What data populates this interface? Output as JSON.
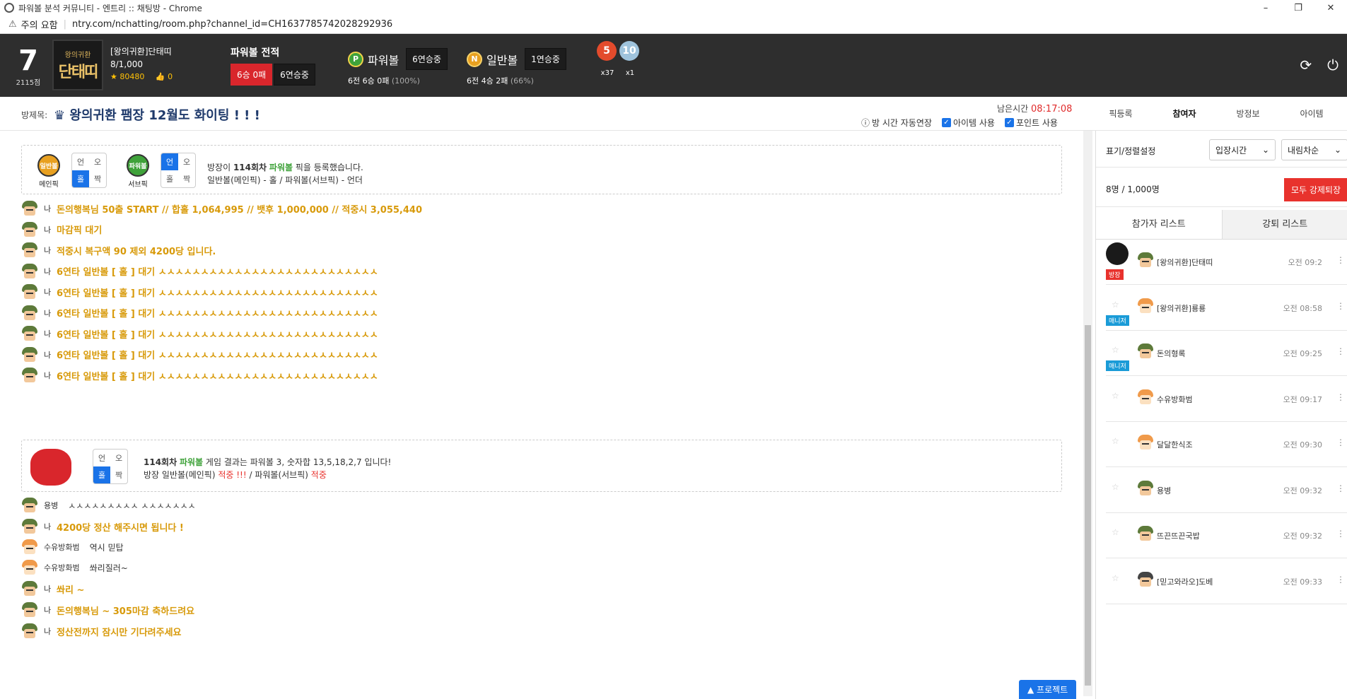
{
  "window": {
    "title": "파워볼 분석 커뮤니티 - 엔트리 :: 채팅방 - Chrome",
    "minimize": "–",
    "restore": "❐",
    "close": "✕"
  },
  "address": {
    "warning": "주의 요함",
    "url": "ntry.com/nchatting/room.php?channel_id=CH1637785742028292936"
  },
  "header": {
    "level": "7",
    "level_points": "2115점",
    "avatar_top": "왕의귀환",
    "avatar_name": "단태띠",
    "user_name": "[왕의귀환]단태띠",
    "user_count": "8/1,000",
    "stars": "80480",
    "likes": "0",
    "powerball_title": "파워볼 전적",
    "pb_record": "6승 0패",
    "pb_streak": "6연승중",
    "powerball": {
      "icon": "P",
      "name": "파워볼",
      "streak": "6연승중",
      "stat": "6전 6승 0패",
      "pct": "(100%)"
    },
    "normalball": {
      "icon": "N",
      "name": "일반볼",
      "streak": "1연승중",
      "stat": "6전 4승 2패",
      "pct": "(66%)"
    },
    "medal1": {
      "num": "5",
      "count": "x37"
    },
    "medal2": {
      "num": "10",
      "count": "x1"
    }
  },
  "room": {
    "label": "방제목:",
    "title": "왕의귀환 팸장 12월도 화이팅 ! ! !",
    "remain_label": "남은시간",
    "remain_time": "08:17:08",
    "auto_extend": "방 시간 자동연장",
    "use_item": "아이템 사용",
    "use_point": "포인트 사용",
    "tabs": [
      "픽등록",
      "참여자",
      "방정보",
      "아이템"
    ]
  },
  "notice1": {
    "ball1": "일반볼",
    "ball1_sub": "메인픽",
    "ball2": "파워볼",
    "ball2_sub": "서브픽",
    "g1": [
      "언",
      "오",
      "홀",
      "짝"
    ],
    "g2": [
      "언",
      "오",
      "홀",
      "짝"
    ],
    "line1_pre": "방장이",
    "line1_round": "114회차",
    "line1_ball": "파워볼",
    "line1_post": "픽을 등록했습니다.",
    "line2": "일반볼(메인픽) - 홀 / 파워볼(서브픽) - 언더"
  },
  "messages": [
    {
      "who": "나",
      "text": "돈의행복님 50출 START // 합홀 1,064,995 // 뱃후 1,000,000 // 적중시 3,055,440"
    },
    {
      "who": "나",
      "text": "마감픽 대기"
    },
    {
      "who": "나",
      "text": "적중시 복구액 90 제외 4200당 입니다."
    },
    {
      "who": "나",
      "text": "6연타 일반볼 [ 홀 ] 대기 ㅅㅅㅅㅅㅅㅅㅅㅅㅅㅅㅅㅅㅅㅅㅅㅅㅅㅅㅅㅅㅅㅅㅅㅅㅅㅅ"
    },
    {
      "who": "나",
      "text": "6연타 일반볼 [ 홀 ] 대기 ㅅㅅㅅㅅㅅㅅㅅㅅㅅㅅㅅㅅㅅㅅㅅㅅㅅㅅㅅㅅㅅㅅㅅㅅㅅㅅ"
    },
    {
      "who": "나",
      "text": "6연타 일반볼 [ 홀 ] 대기 ㅅㅅㅅㅅㅅㅅㅅㅅㅅㅅㅅㅅㅅㅅㅅㅅㅅㅅㅅㅅㅅㅅㅅㅅㅅㅅ"
    },
    {
      "who": "나",
      "text": "6연타 일반볼 [ 홀 ] 대기 ㅅㅅㅅㅅㅅㅅㅅㅅㅅㅅㅅㅅㅅㅅㅅㅅㅅㅅㅅㅅㅅㅅㅅㅅㅅㅅ"
    },
    {
      "who": "나",
      "text": "6연타 일반볼 [ 홀 ] 대기 ㅅㅅㅅㅅㅅㅅㅅㅅㅅㅅㅅㅅㅅㅅㅅㅅㅅㅅㅅㅅㅅㅅㅅㅅㅅㅅ"
    },
    {
      "who": "나",
      "text": "6연타 일반볼 [ 홀 ] 대기 ㅅㅅㅅㅅㅅㅅㅅㅅㅅㅅㅅㅅㅅㅅㅅㅅㅅㅅㅅㅅㅅㅅㅅㅅㅅㅅ"
    }
  ],
  "notice2": {
    "g": [
      "언",
      "오",
      "홀",
      "짝"
    ],
    "round": "114회차",
    "ball": "파워볼",
    "line1": "게임 결과는 파워볼 3, 숫자합 13,5,18,2,7 입니다!",
    "line2_pre": "방장 일반볼(메인픽)",
    "hit1": "적중 !!!",
    "line2_mid": "/ 파워볼(서브픽)",
    "hit2": "적중"
  },
  "messages2": [
    {
      "who": "용병",
      "text": "ㅅㅅㅅㅅㅅㅅㅅㅅㅅ ㅅㅅㅅㅅㅅㅅㅅ",
      "type": "other"
    },
    {
      "who": "나",
      "text": "4200당 정산 해주시면 됩니다 !",
      "type": "me"
    },
    {
      "who": "수유방화범",
      "text": "역시 믿탑",
      "type": "other"
    },
    {
      "who": "수유방화범",
      "text": "쏴리질러~",
      "type": "other"
    },
    {
      "who": "나",
      "text": "쏴리 ~",
      "type": "me"
    },
    {
      "who": "나",
      "text": "돈의행복님 ~ 305마감 축하드려요",
      "type": "me"
    },
    {
      "who": "나",
      "text": "정산전까지 잠시만 기다려주세요",
      "type": "me"
    }
  ],
  "protect": "▲ 프로젝트",
  "sidebar": {
    "display_label": "표기/정렬설정",
    "sort1": "입장시간",
    "sort2": "내림차순",
    "count": "8명 / 1,000명",
    "kick_all": "모두 강제퇴장",
    "tab_participants": "참가자 리스트",
    "tab_kicked": "강퇴 리스트",
    "participants": [
      {
        "name": "[왕의귀환]단태띠",
        "time": "오전 09:2",
        "badge": "방장"
      },
      {
        "name": "[왕의귀환]룡룡",
        "time": "오전 08:58",
        "badge": "매니저"
      },
      {
        "name": "돈의형록",
        "time": "오전 09:25",
        "badge": "매니저"
      },
      {
        "name": "수유방화범",
        "time": "오전 09:17",
        "badge": ""
      },
      {
        "name": "달달한식조",
        "time": "오전 09:30",
        "badge": ""
      },
      {
        "name": "용병",
        "time": "오전 09:32",
        "badge": ""
      },
      {
        "name": "뜨끈뜨끈국밥",
        "time": "오전 09:32",
        "badge": ""
      },
      {
        "name": "[믿고와라오]도베",
        "time": "오전 09:33",
        "badge": ""
      }
    ]
  },
  "colors": {
    "accent": "#1a73e8",
    "danger": "#e8322d",
    "gold": "#d89a0a",
    "header": "#2e2e2e"
  }
}
